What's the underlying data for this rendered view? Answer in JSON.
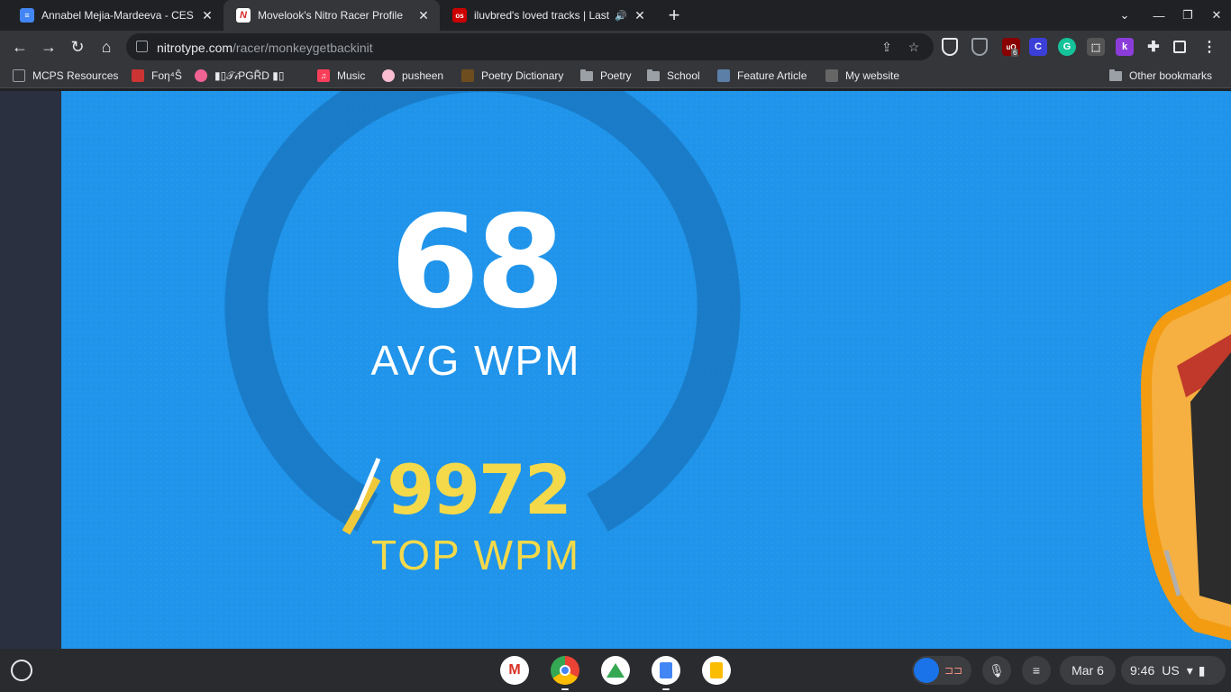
{
  "tabs": [
    {
      "title": "Annabel Mejia-Mardeeva - CES T",
      "favicon": "docs-icon",
      "active": false
    },
    {
      "title": "Movelook's Nitro Racer Profile",
      "favicon": "nitrotype-icon",
      "active": true
    },
    {
      "title": "iluvbred's loved tracks | Last",
      "favicon": "lastfm-icon",
      "active": false
    }
  ],
  "address_bar": {
    "host": "nitrotype.com",
    "path": "/racer/monkeygetbackinit"
  },
  "extension_badge": "6",
  "bookmarks": [
    {
      "label": "MCPS Resources"
    },
    {
      "label": "Foη⁴Ŝ"
    },
    {
      "label": "▮▯𝒯𝒾PGR̃D ▮▯"
    },
    {
      "label": "Music"
    },
    {
      "label": "pusheen"
    },
    {
      "label": "Poetry Dictionary"
    },
    {
      "label": "Poetry"
    },
    {
      "label": "School"
    },
    {
      "label": "Feature Article"
    },
    {
      "label": "My website"
    },
    {
      "label": "Other bookmarks"
    }
  ],
  "stats": {
    "avg_value": "68",
    "avg_label": "AVG WPM",
    "top_value": "9972",
    "top_label": "TOP WPM"
  },
  "shelf": {
    "date": "Mar 6",
    "time": "9:46",
    "locale": "US"
  },
  "colors": {
    "stage_bg": "#1f94ea",
    "ring": "#1a78c2",
    "top_yellow": "#f4d94a"
  }
}
